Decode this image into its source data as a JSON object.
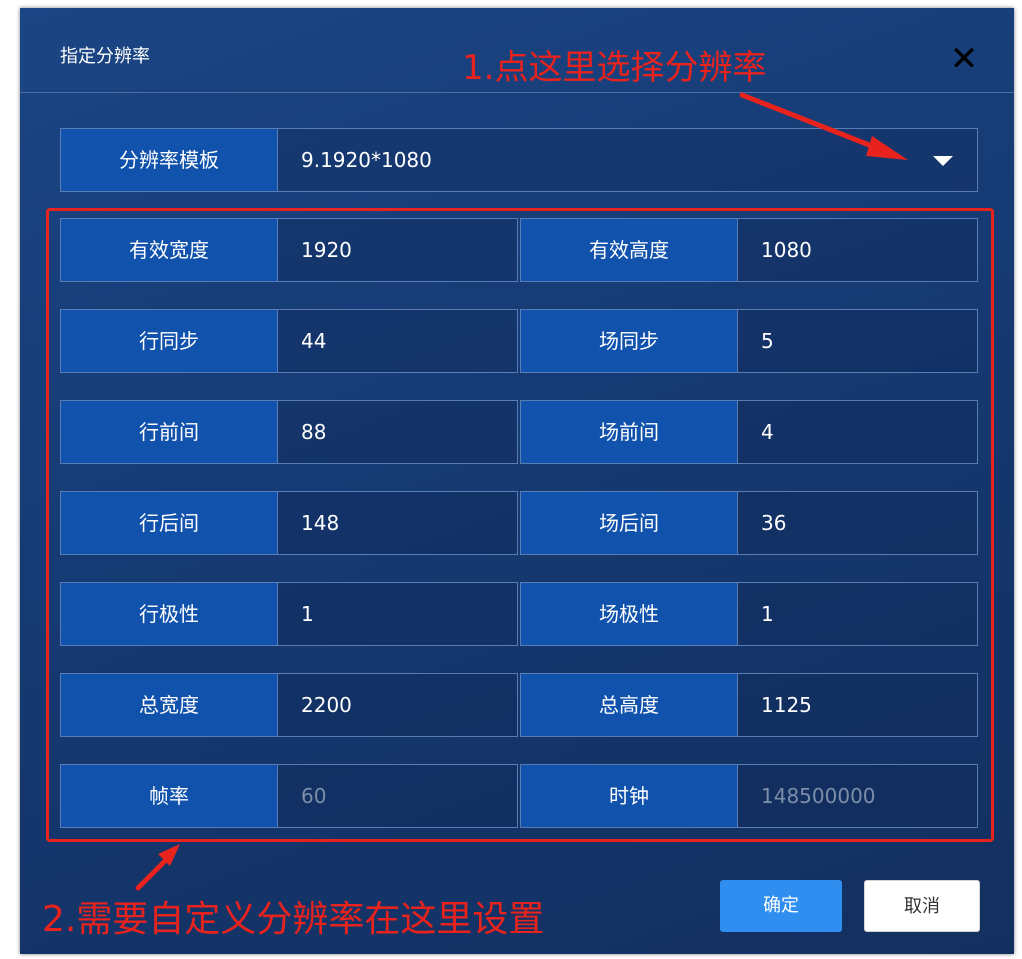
{
  "dialog": {
    "title": "指定分辨率",
    "close_glyph": "✕"
  },
  "annotations": {
    "step1": "1.点这里选择分辨率",
    "step2": "2.需要自定义分辨率在这里设置",
    "color": "#e8231d"
  },
  "template": {
    "label": "分辨率模板",
    "value": "9.1920*1080",
    "caret_icon": "caret-down-icon"
  },
  "fields": {
    "rows": [
      {
        "left_label": "有效宽度",
        "left_value": "1920",
        "right_label": "有效高度",
        "right_value": "1080"
      },
      {
        "left_label": "行同步",
        "left_value": "44",
        "right_label": "场同步",
        "right_value": "5"
      },
      {
        "left_label": "行前间",
        "left_value": "88",
        "right_label": "场前间",
        "right_value": "4"
      },
      {
        "left_label": "行后间",
        "left_value": "148",
        "right_label": "场后间",
        "right_value": "36"
      },
      {
        "left_label": "行极性",
        "left_value": "1",
        "right_label": "场极性",
        "right_value": "1"
      },
      {
        "left_label": "总宽度",
        "left_value": "2200",
        "right_label": "总高度",
        "right_value": "1125"
      },
      {
        "left_label": "帧率",
        "left_value": "60",
        "right_label": "时钟",
        "right_value": "148500000"
      }
    ]
  },
  "buttons": {
    "ok": "确定",
    "cancel": "取消"
  },
  "colors": {
    "label_bg": "#1152ad",
    "ok_bg": "#2f8ef0",
    "disabled_text": "#7c8ea8"
  }
}
